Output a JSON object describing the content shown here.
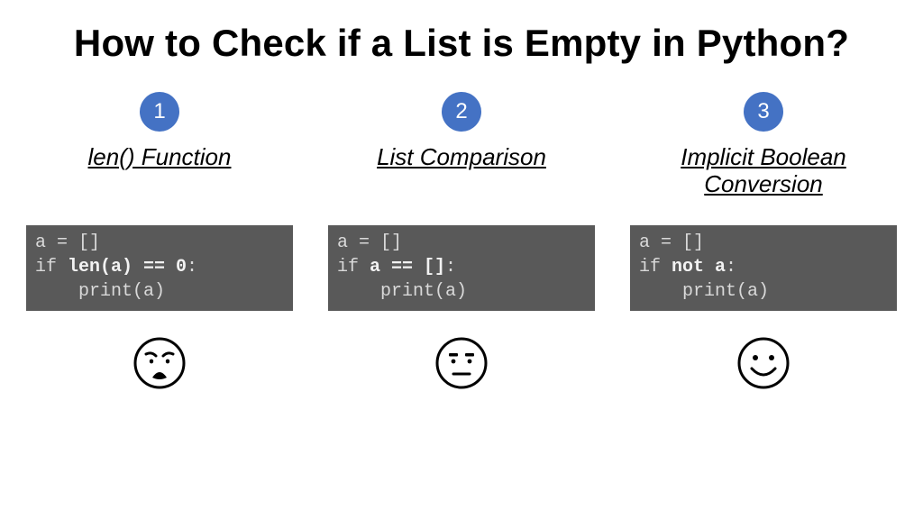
{
  "title": "How to Check if a List is Empty in Python?",
  "columns": [
    {
      "num": "1",
      "heading": "len() Function",
      "code_line1": "a = []",
      "code_if": "if ",
      "code_bold": "len(a) == 0",
      "code_colon": ":",
      "code_body": "    print(a)",
      "face": "weary"
    },
    {
      "num": "2",
      "heading": "List Comparison",
      "code_line1": "a = []",
      "code_if": "if ",
      "code_bold": "a == []",
      "code_colon": ":",
      "code_body": "    print(a)",
      "face": "neutral"
    },
    {
      "num": "3",
      "heading": "Implicit Boolean Conversion",
      "code_line1": "a = []",
      "code_if": "if ",
      "code_bold": "not a",
      "code_colon": ":",
      "code_body": "    print(a)",
      "face": "happy"
    }
  ]
}
